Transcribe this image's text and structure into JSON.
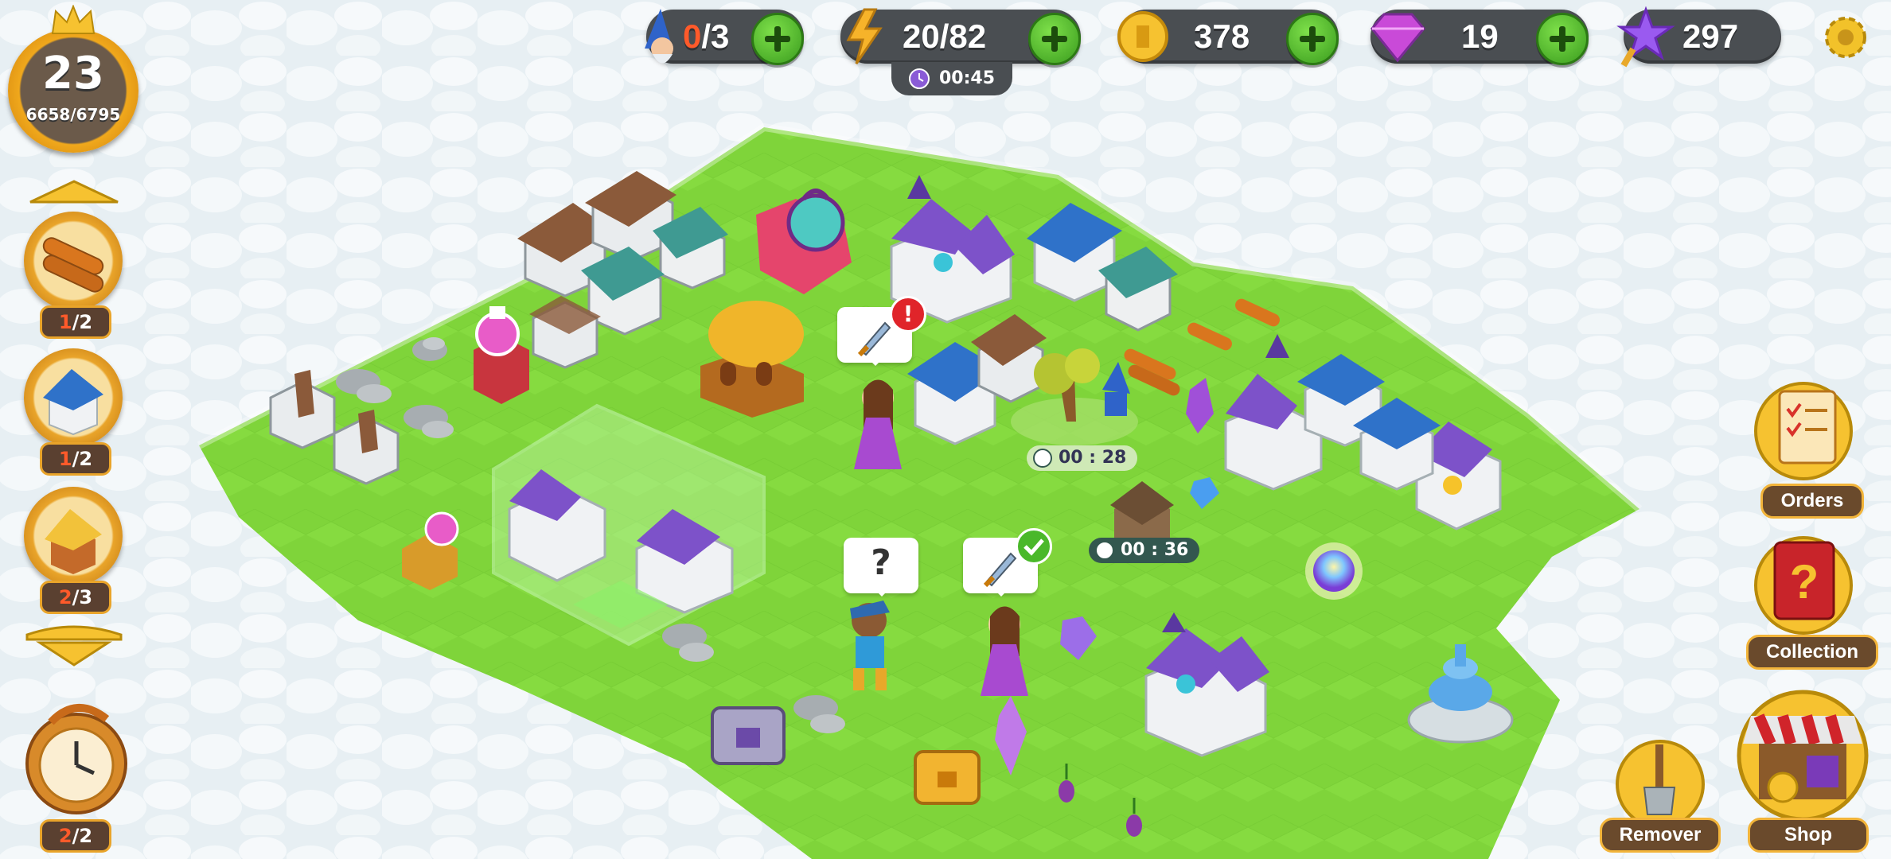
{
  "resources": {
    "wizards": {
      "current": "0",
      "max": "/3"
    },
    "energy": {
      "value": "20/82",
      "timer": "00:45"
    },
    "coins": {
      "value": "378"
    },
    "gems": {
      "value": "19"
    },
    "stars": {
      "value": "297"
    }
  },
  "level": {
    "number": "23",
    "xp": "6658/6795",
    "xp_fraction": 0.98
  },
  "left_queue": [
    {
      "icon": "logs-icon",
      "count_current": "1",
      "count_rest": "/2"
    },
    {
      "icon": "blue-house-icon",
      "count_current": "1",
      "count_rest": "/2"
    },
    {
      "icon": "thatched-hut-icon",
      "count_current": "2",
      "count_rest": "/3"
    }
  ],
  "stopwatch": {
    "count_current": "2",
    "count_rest": "/2"
  },
  "right_buttons": {
    "orders": "Orders",
    "collection": "Collection",
    "remover": "Remover",
    "shop": "Shop"
  },
  "map_timers": {
    "tree_timer": "00 : 28",
    "hut_timer": "00 : 36"
  },
  "bubbles": {
    "question": "?"
  },
  "colors": {
    "grass": "#7dd83a",
    "clouds": "#eef4f7",
    "pill": "#4a4e52",
    "plus": "#4fbe2a",
    "gold": "#f0a81c"
  }
}
